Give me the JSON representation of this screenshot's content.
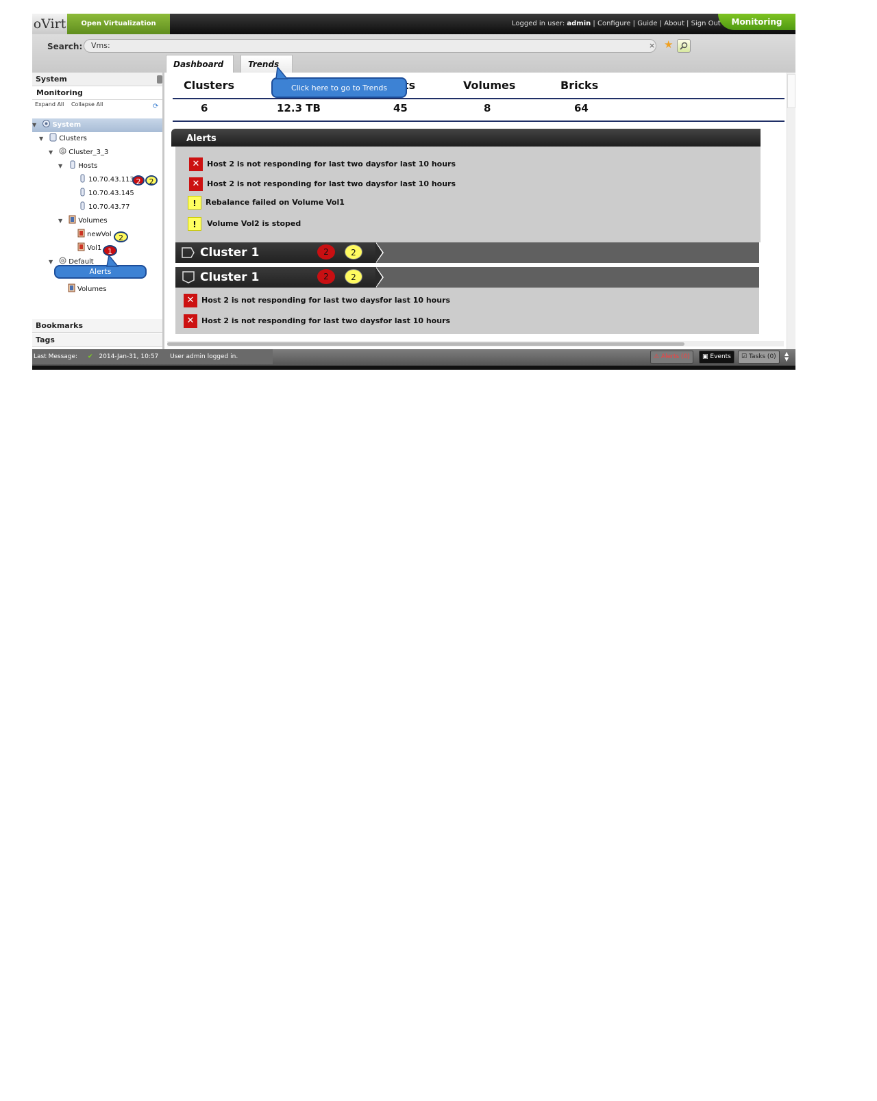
{
  "header": {
    "logo": "oVirt",
    "product": "Open Virtualization Manager",
    "logged_in_prefix": "Logged in user:",
    "user": "admin",
    "links": [
      "Configure",
      "Guide",
      "About",
      "Sign Out"
    ],
    "mode_tab": "Monitoring",
    "mode_tab_color": "#5fa818"
  },
  "search": {
    "label": "Search:",
    "value": "Vms:",
    "clear_icon": "×",
    "star_icon": "★"
  },
  "tabs": [
    {
      "label": "Dashboard"
    },
    {
      "label": "Trends"
    }
  ],
  "callouts": {
    "trends": "Click here to go to Trends",
    "alerts": "Alerts"
  },
  "leftpanel": {
    "system": "System",
    "monitoring": "Monitoring",
    "expand_all": "Expand All",
    "collapse_all": "Collapse All",
    "tree": {
      "system": "System",
      "clusters": "Clusters",
      "cluster_3_3": "Cluster_3_3",
      "hosts": "Hosts",
      "host1": "10.70.43.113",
      "host1_red": "2",
      "host1_yellow": "2",
      "host2": "10.70.43.145",
      "host3": "10.70.43.77",
      "volumes": "Volumes",
      "newvol": "newVol",
      "newvol_yellow": "2",
      "vol1": "Vol1",
      "vol1_red": "1",
      "default": "Default",
      "default_volumes": "Volumes"
    },
    "bookmarks": "Bookmarks",
    "tags": "Tags"
  },
  "summary": [
    {
      "label": "Clusters",
      "value": "6"
    },
    {
      "label": "",
      "value": "12.3 TB"
    },
    {
      "label": "ts",
      "value": "45"
    },
    {
      "label": "Volumes",
      "value": "8"
    },
    {
      "label": "Bricks",
      "value": "64"
    }
  ],
  "alerts": {
    "title": "Alerts",
    "items": [
      {
        "type": "error",
        "icon": "x-icon",
        "text": "Host 2 is not responding for last two daysfor last 10 hours"
      },
      {
        "type": "error",
        "icon": "x-icon",
        "text": "Host 2 is not responding for last two daysfor last 10 hours"
      },
      {
        "type": "warning",
        "icon": "warning-icon",
        "text": "Rebalance failed on Volume Vol1"
      },
      {
        "type": "warning",
        "icon": "warning-icon",
        "text": "Volume Vol2 is stoped"
      }
    ]
  },
  "clusters": [
    {
      "title": "Cluster  1",
      "red": "2",
      "yellow": "2",
      "expanded": false
    },
    {
      "title": "Cluster  1",
      "red": "2",
      "yellow": "2",
      "expanded": true
    }
  ],
  "cluster_alerts": [
    {
      "text": "Host 2 is not responding for last two daysfor last 10 hours"
    },
    {
      "text": "Host 2 is not responding for last two daysfor last 10 hours"
    }
  ],
  "footer": {
    "last_message_label": "Last Message:",
    "timestamp": "2014-Jan-31, 10:57",
    "message": "User admin logged in.",
    "alerts": "Alerts (0)",
    "events": "Events",
    "tasks": "Tasks (0)"
  },
  "colors": {
    "error": "#cc1111",
    "warning": "#ffff60",
    "callout": "#3d82d4"
  }
}
